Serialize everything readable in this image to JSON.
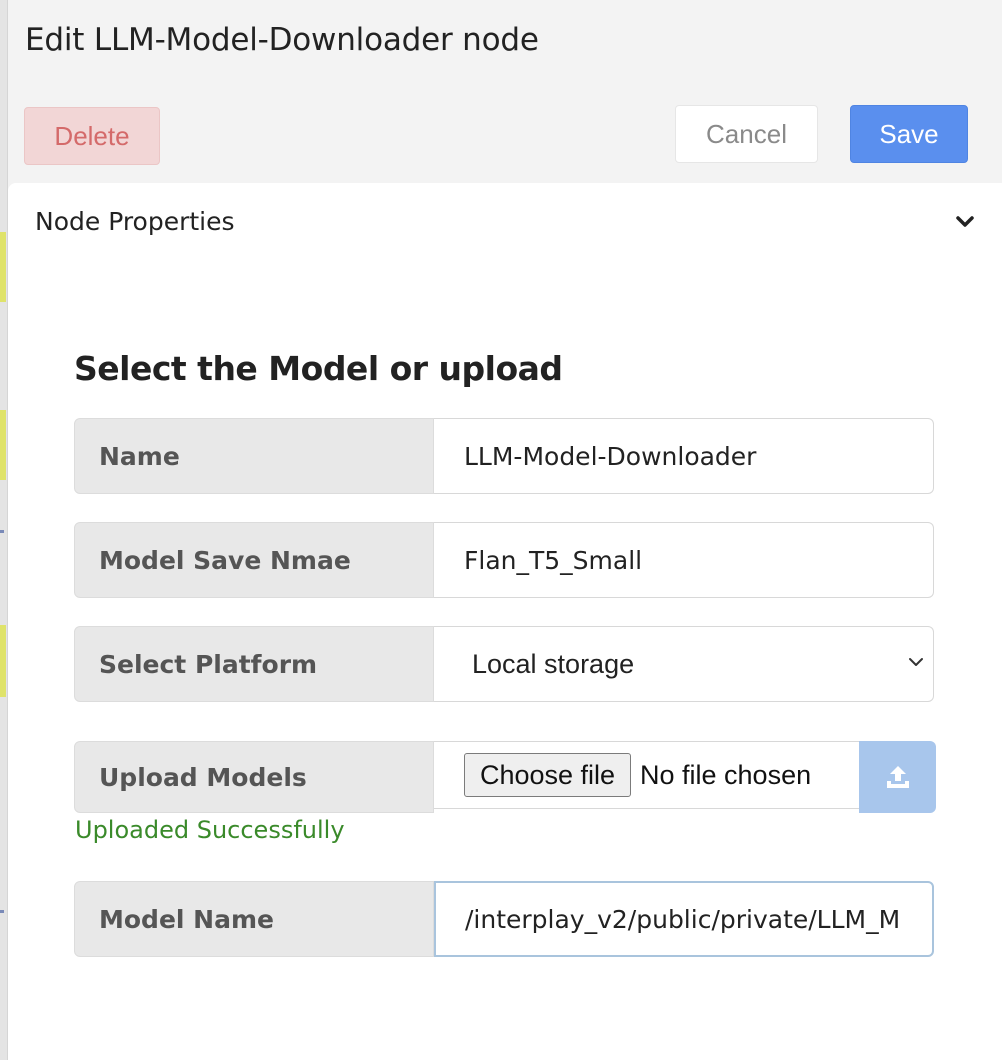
{
  "dialog": {
    "title": "Edit LLM-Model-Downloader node",
    "delete_label": "Delete",
    "cancel_label": "Cancel",
    "save_label": "Save"
  },
  "section": {
    "title": "Node Properties",
    "icon": "chevron-down-icon"
  },
  "form": {
    "heading": "Select the Model or upload",
    "name": {
      "label": "Name",
      "value": "LLM-Model-Downloader"
    },
    "model_save_name": {
      "label": "Model Save Nmae",
      "value": "Flan_T5_Small"
    },
    "platform": {
      "label": "Select Platform",
      "selected": "Local storage",
      "icon": "chevron-down-icon"
    },
    "upload": {
      "label": "Upload Models",
      "choose_label": "Choose file",
      "file_status": "No file chosen",
      "icon": "upload-icon",
      "status": "Uploaded Successfully"
    },
    "model_name": {
      "label": "Model Name",
      "value": "/interplay_v2/public/private/LLM_M"
    }
  },
  "colors": {
    "save": "#5a8fee",
    "delete_bg": "#f2d6d6",
    "delete_text": "#d46a6a",
    "success": "#3a8a2a",
    "upload_button": "#a8c6ec"
  }
}
